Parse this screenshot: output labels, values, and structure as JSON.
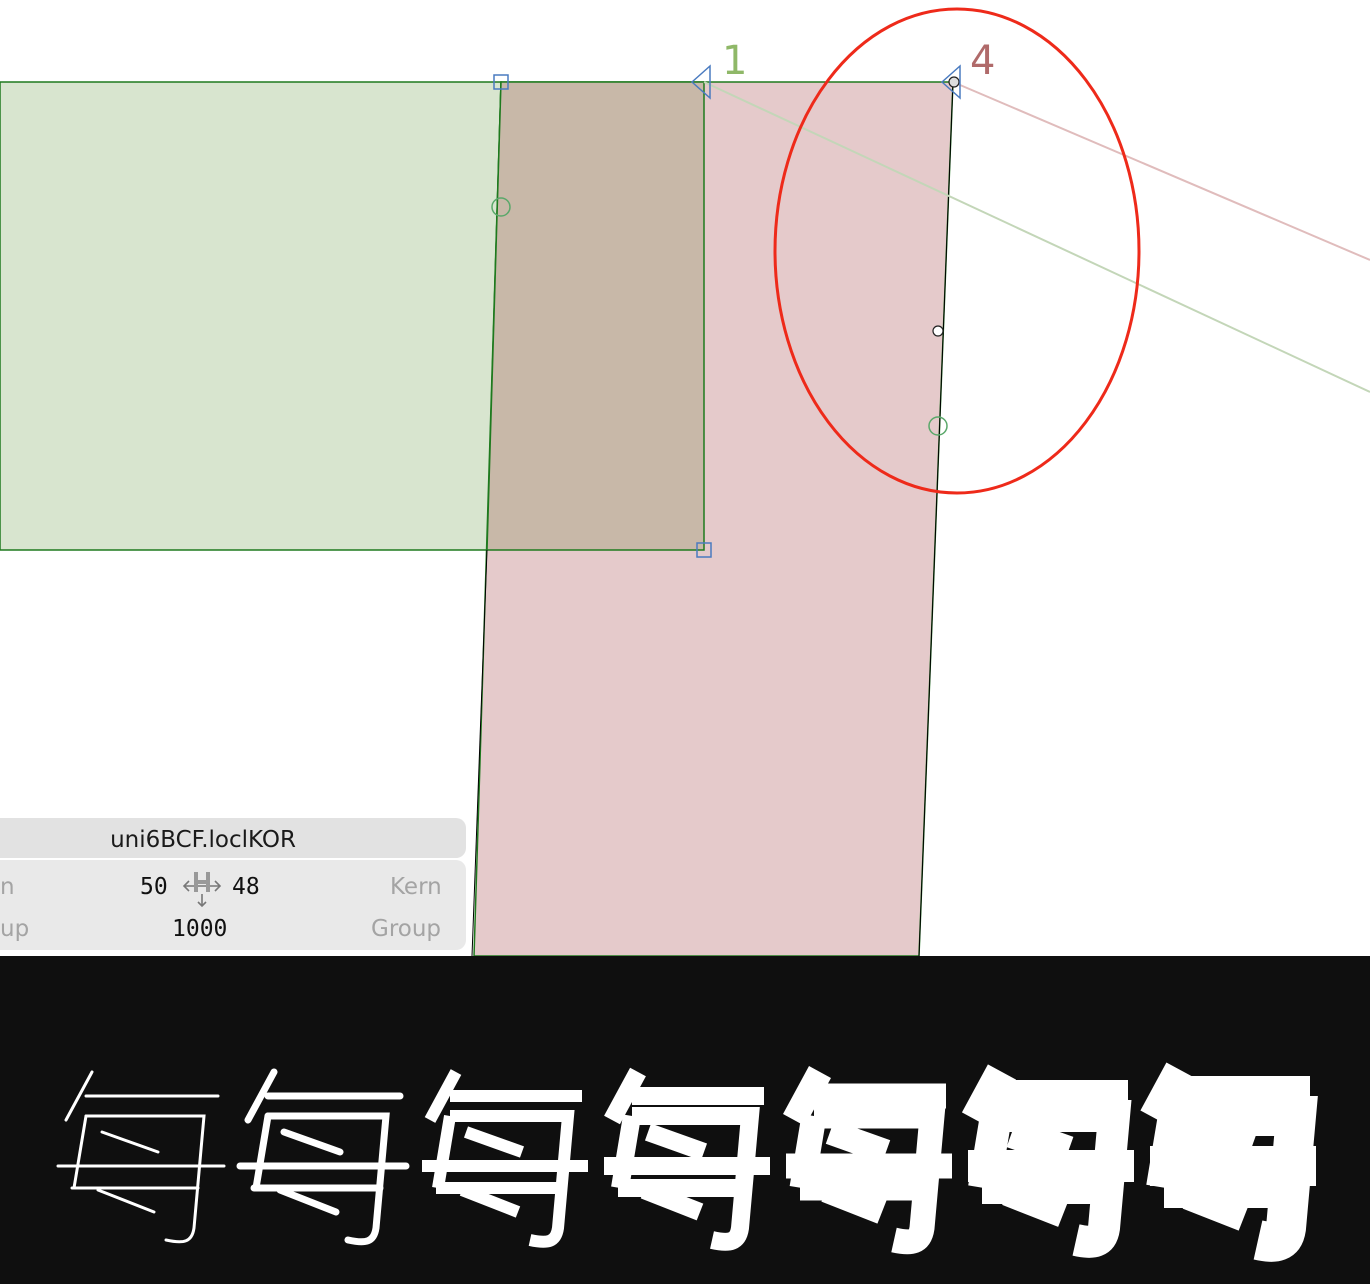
{
  "canvas": {
    "node_labels": {
      "left_stroke": "1",
      "right_stroke": "4"
    },
    "colors": {
      "left_fill": "#d8e5cf",
      "right_fill": "#e5cacb",
      "overlap_fill": "#c8b8a8",
      "outline": "#1e7a1e",
      "highlight_circle": "#ee2a1a",
      "node_blue": "#4a7bc0",
      "node_green": "#5aa86a",
      "label_green": "#8fb868",
      "label_red": "#b06a6a"
    }
  },
  "info_panel": {
    "glyph_name": "uni6BCF.loclKOR",
    "left_sidebearing": "50",
    "right_sidebearing": "48",
    "width": "1000",
    "left_kern_label": "n",
    "left_group_label": "up",
    "right_kern_label": "Kern",
    "right_group_label": "Group",
    "metrics_icon": "sidebearing-arrows-icon"
  },
  "preview": {
    "weights": [
      {
        "name": "weight-1",
        "label": ""
      },
      {
        "name": "weight-2",
        "label": ""
      },
      {
        "name": "weight-3",
        "label": ""
      },
      {
        "name": "weight-4",
        "label": ""
      },
      {
        "name": "weight-5",
        "label": ""
      },
      {
        "name": "weight-6",
        "label": ""
      },
      {
        "name": "weight-7",
        "label": ""
      }
    ],
    "glyph_char": "每"
  }
}
